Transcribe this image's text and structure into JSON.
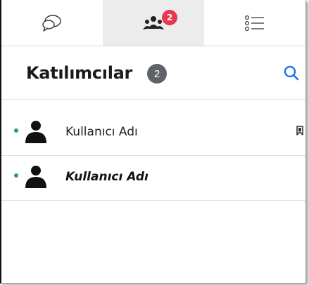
{
  "tabs": [
    {
      "icon": "chat-bubbles-icon",
      "active": false
    },
    {
      "icon": "participants-icon",
      "active": true,
      "badge": "2"
    },
    {
      "icon": "list-icon",
      "active": false
    }
  ],
  "header": {
    "title": "Katılımcılar",
    "count": "2",
    "search_icon": "search-icon"
  },
  "participants": [
    {
      "name": "Kullanıcı Adı",
      "online": true,
      "bookmarked": true,
      "emphasis": false
    },
    {
      "name": "Kullanıcı Adı",
      "online": true,
      "bookmarked": false,
      "emphasis": true
    }
  ],
  "colors": {
    "accent": "#1a73e8",
    "badge": "#e8384f",
    "online": "#2e9e5b",
    "count_pill": "#5f6368"
  }
}
